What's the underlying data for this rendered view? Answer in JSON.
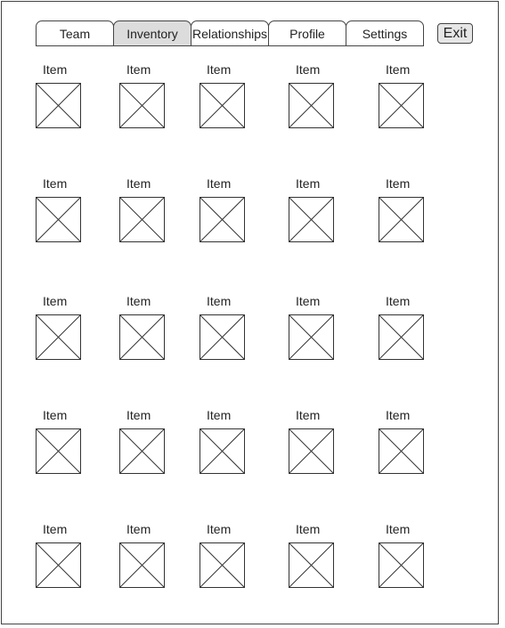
{
  "tabs": [
    {
      "label": "Team",
      "active": false
    },
    {
      "label": "Inventory",
      "active": true
    },
    {
      "label": "Relationships",
      "active": false
    },
    {
      "label": "Profile",
      "active": false
    },
    {
      "label": "Settings",
      "active": false
    }
  ],
  "exit_label": "Exit",
  "inventory": {
    "rows": [
      [
        "Item",
        "Item",
        "Item",
        "Item",
        "Item"
      ],
      [
        "Item",
        "Item",
        "Item",
        "Item",
        "Item"
      ],
      [
        "Item",
        "Item",
        "Item",
        "Item",
        "Item"
      ],
      [
        "Item",
        "Item",
        "Item",
        "Item",
        "Item"
      ],
      [
        "Item",
        "Item",
        "Item",
        "Item",
        "Item"
      ]
    ],
    "image_placeholder_icon": "image-placeholder-icon"
  }
}
